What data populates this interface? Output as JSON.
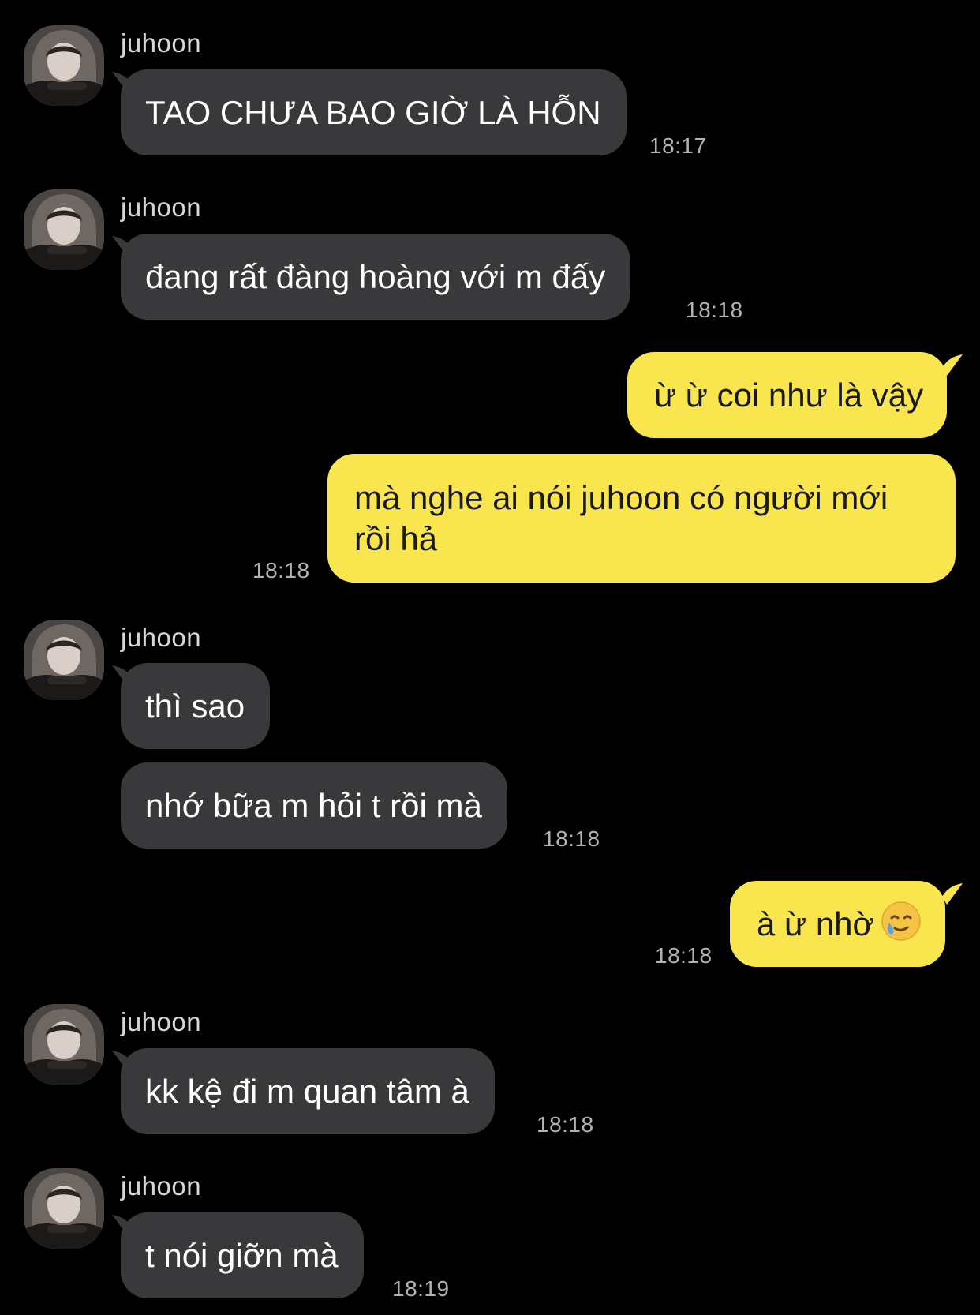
{
  "conversation": {
    "sender_name": "juhoon",
    "messages": [
      {
        "direction": "incoming",
        "text": "TAO CHƯA BAO GIỜ LÀ HỖN",
        "time": "18:17"
      },
      {
        "direction": "incoming",
        "text": "đang rất đàng hoàng với m đấy",
        "time": "18:18"
      },
      {
        "direction": "outgoing",
        "text": "ừ ừ coi như là vậy"
      },
      {
        "direction": "outgoing",
        "text": "mà nghe ai nói juhoon có người mới rồi hả",
        "time": "18:18"
      },
      {
        "direction": "incoming",
        "text": "thì sao"
      },
      {
        "direction": "incoming",
        "text": "nhớ bữa m hỏi t rồi mà",
        "time": "18:18"
      },
      {
        "direction": "outgoing",
        "text": "à ừ nhờ",
        "emoji": "smiling-face-with-tear-icon",
        "time": "18:18"
      },
      {
        "direction": "incoming",
        "text": "kk kệ đi m quan tâm à",
        "time": "18:18"
      },
      {
        "direction": "incoming",
        "text": "t nói giỡn mà",
        "time": "18:19"
      }
    ]
  },
  "colors": {
    "background": "#000000",
    "incoming_bubble": "#39393b",
    "outgoing_bubble": "#f9e64f",
    "timestamp": "#b3b3b3"
  }
}
